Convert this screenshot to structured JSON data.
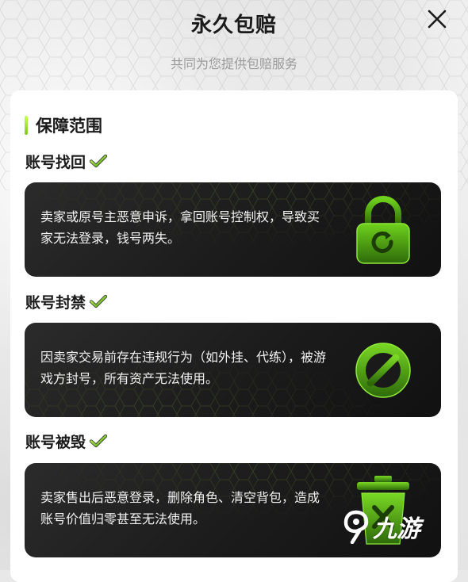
{
  "header": {
    "title": "永久包赔",
    "subtitle": "共同为您提供包赔服务"
  },
  "section": {
    "title": "保障范围"
  },
  "items": [
    {
      "label": "账号找回",
      "description": "卖家或原号主恶意申诉，拿回账号控制权，导致买家无法登录，钱号两失。",
      "icon": "lock-refresh-icon"
    },
    {
      "label": "账号封禁",
      "description": "因卖家交易前存在违规行为（如外挂、代练），被游戏方封号，所有资产无法使用。",
      "icon": "ban-icon"
    },
    {
      "label": "账号被毁",
      "description": "卖家售出后恶意登录，删除角色、清空背包，造成账号价值归零甚至无法使用。",
      "icon": "trash-icon"
    }
  ],
  "watermark": {
    "text": "九游",
    "logo": "jiuyou-logo"
  },
  "colors": {
    "accent": "#7ecb1a",
    "accent_light": "#c8ff5a",
    "card_bg": "#1f1f1f",
    "title": "#1a1a1a",
    "subtitle": "#9a9a9a"
  }
}
